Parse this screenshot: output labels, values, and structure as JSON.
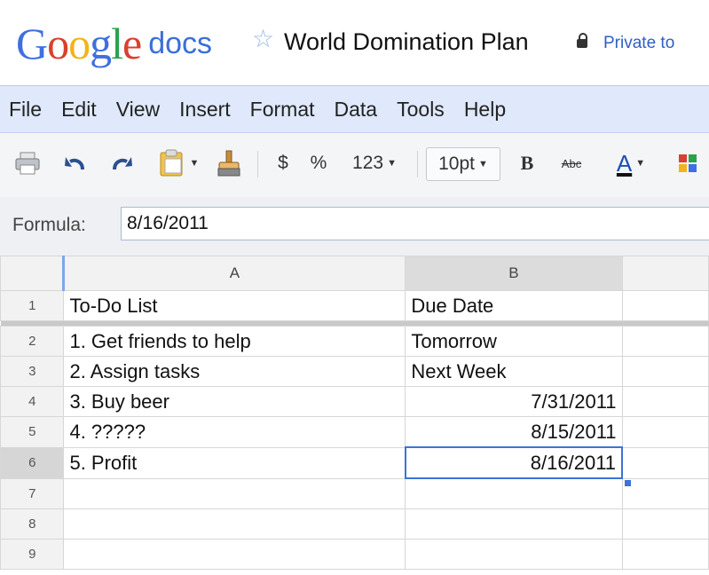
{
  "app": {
    "logo_google": "Google",
    "logo_docs": "docs",
    "title": "World Domination Plan",
    "sharing": "Private to"
  },
  "logo_colors": [
    "#3f6fe0",
    "#d8412f",
    "#f2b41a",
    "#3f6fe0",
    "#2aa14c",
    "#d8412f"
  ],
  "menu": [
    "File",
    "Edit",
    "View",
    "Insert",
    "Format",
    "Data",
    "Tools",
    "Help"
  ],
  "toolbar": {
    "currency": "$",
    "percent": "%",
    "number_format": "123",
    "font_size": "10pt",
    "bold": "B",
    "strikethrough": "Abc",
    "text_color": "A"
  },
  "formula": {
    "label": "Formula:",
    "value": "8/16/2011"
  },
  "sheet": {
    "columns": [
      "A",
      "B"
    ],
    "rows": [
      {
        "num": "1",
        "a": "To-Do List",
        "b": "Due Date"
      },
      {
        "num": "2",
        "a": "1. Get friends to help",
        "b": "Tomorrow"
      },
      {
        "num": "3",
        "a": "2. Assign tasks",
        "b": "Next Week"
      },
      {
        "num": "4",
        "a": "3. Buy beer",
        "b": "7/31/2011"
      },
      {
        "num": "5",
        "a": "4. ?????",
        "b": "8/15/2011"
      },
      {
        "num": "6",
        "a": "5. Profit",
        "b": "8/16/2011"
      },
      {
        "num": "7",
        "a": "",
        "b": ""
      },
      {
        "num": "8",
        "a": "",
        "b": ""
      },
      {
        "num": "9",
        "a": "",
        "b": ""
      }
    ]
  }
}
